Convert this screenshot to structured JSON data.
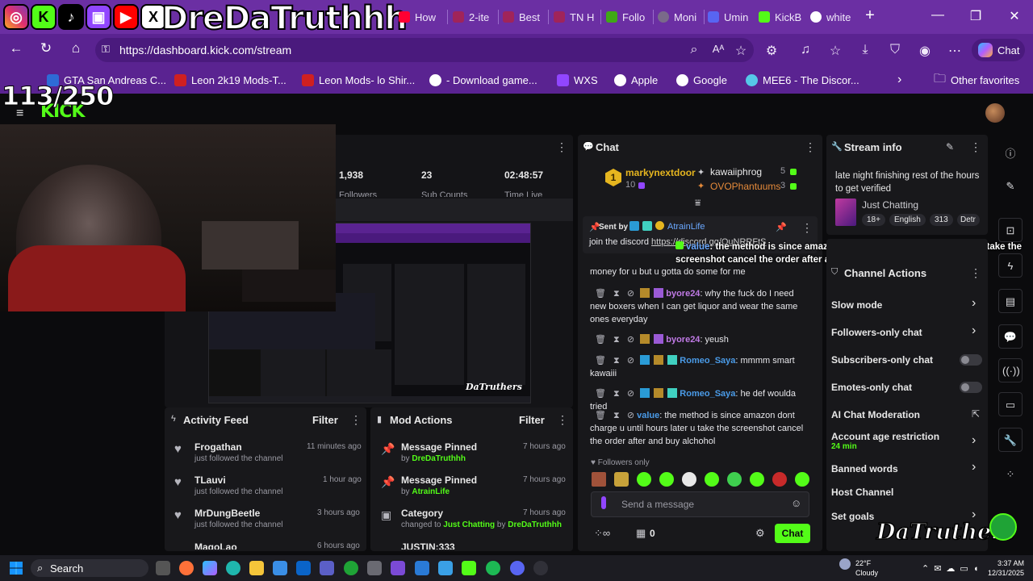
{
  "overlay": {
    "channel_name": "DreDaTruthhh",
    "follower_goal": "113/250",
    "brand_watermark": "DaTruthers",
    "social_icons": [
      "instagram-icon",
      "kick-icon",
      "tiktok-icon",
      "twitch-icon",
      "youtube-icon",
      "x-icon"
    ]
  },
  "browser": {
    "tabs": [
      {
        "label": "How",
        "icon": "youtube-icon"
      },
      {
        "label": "2-ite",
        "icon": "youtube-icon"
      },
      {
        "label": "Best",
        "icon": "youtube-icon"
      },
      {
        "label": "TN H",
        "icon": "youtube-icon"
      },
      {
        "label": "Follo",
        "icon": "kick-icon"
      },
      {
        "label": "Moni",
        "icon": "globe-icon"
      },
      {
        "label": "Umin",
        "icon": "discord-icon"
      },
      {
        "label": "KickB",
        "icon": "kick-icon"
      },
      {
        "label": "white",
        "icon": "google-icon"
      }
    ],
    "new_tab": "+",
    "url": "https://dashboard.kick.com/stream",
    "chat_button": "Chat",
    "bookmarks": [
      "GTA San Andreas C...",
      "Leon 2k19 Mods-T...",
      "Leon Mods- lo Shir...",
      "- Download game...",
      "WXS",
      "Apple",
      "Google",
      "MEE6 - The Discor..."
    ],
    "other_favorites": "Other favorites"
  },
  "stats": {
    "viewers": "1,938",
    "sub_count_value": "23",
    "time_live": "02:48:57",
    "followers_label": "Followers",
    "subs_label": "Sub Counts",
    "time_label": "Time Live"
  },
  "chat": {
    "title": "Chat",
    "leaderboard": [
      {
        "rank": "1",
        "name": "markynextdoor",
        "count": "10"
      },
      {
        "name": "kawaiiphrog",
        "count": "5"
      },
      {
        "name": "OVOPhantuums",
        "count": "3"
      }
    ],
    "pinned": {
      "sent_by_label": "Sent by",
      "sender": "AtrainLife",
      "message_start": "join the discord ",
      "link": "https://discord.gg/OuNRRFtS"
    },
    "overlay_message": {
      "user": "value",
      "text": ": the method is since amazon dont charge u until hours later u take the screenshot cancel the order after and buy alchohol"
    },
    "lines": [
      {
        "user": "",
        "text": "money for u but u gotta do some for me"
      },
      {
        "user": "byore24",
        "text": ": why the fuck do I need new boxers when I can get liquor and wear the same ones everyday"
      },
      {
        "user": "byore24",
        "text": ": yeush"
      },
      {
        "user": "Romeo_Saya",
        "text": ": mmmm smart kawaiii"
      },
      {
        "user": "Romeo_Saya",
        "text": ": he def woulda tried"
      },
      {
        "user": "value",
        "text": ": the method is since amazon dont charge u until hours later u take the screenshot cancel the order after and buy alchohol"
      }
    ],
    "followers_only_label": "Followers only",
    "input_placeholder": "Send a message",
    "points_value": "0",
    "send_button": "Chat"
  },
  "stream_info": {
    "title": "Stream info",
    "stream_title": "late night finishing rest of the hours to get verified",
    "category": "Just Chatting",
    "tags": [
      "18+",
      "English",
      "313",
      "Detr"
    ]
  },
  "channel_actions": {
    "title": "Channel Actions",
    "items": [
      {
        "label": "Slow mode"
      },
      {
        "label": "Followers-only chat"
      },
      {
        "label": "Subscribers-only chat"
      },
      {
        "label": "Emotes-only chat"
      },
      {
        "label": "AI Chat Moderation"
      },
      {
        "label": "Account age restriction",
        "sub": "24 min"
      },
      {
        "label": "Banned words"
      },
      {
        "label": "Host Channel"
      },
      {
        "label": "Set goals"
      }
    ]
  },
  "activity_feed": {
    "title": "Activity Feed",
    "filter": "Filter",
    "items": [
      {
        "name": "Frogathan",
        "desc": "just followed the channel",
        "time": "11 minutes ago"
      },
      {
        "name": "TLauvi",
        "desc": "just followed the channel",
        "time": "1 hour ago"
      },
      {
        "name": "MrDungBeetle",
        "desc": "just followed the channel",
        "time": "3 hours ago"
      },
      {
        "name": "MagoLao",
        "desc": "",
        "time": "6 hours ago"
      }
    ]
  },
  "mod_actions": {
    "title": "Mod Actions",
    "filter": "Filter",
    "items": [
      {
        "title": "Message Pinned",
        "by_label": "by ",
        "by": "DreDaTruthhh",
        "time": "7 hours ago"
      },
      {
        "title": "Message Pinned",
        "by_label": "by ",
        "by": "AtrainLife",
        "time": "7 hours ago"
      },
      {
        "title": "Category",
        "by_label": "changed to ",
        "by": "Just Chatting",
        "by2_label": " by ",
        "by2": "DreDaTruthhh",
        "time": "7 hours ago"
      },
      {
        "title": "JUSTIN:333",
        "time": ""
      }
    ]
  },
  "taskbar": {
    "search": "Search",
    "weather_temp": "22°F",
    "weather_desc": "Cloudy",
    "time": "3:37 AM",
    "date": "12/31/2025"
  },
  "colors": {
    "kick_green": "#53fc18",
    "browser_purple": "#5a2391",
    "panel_bg": "#18181b",
    "page_bg": "#0b0b0d"
  }
}
